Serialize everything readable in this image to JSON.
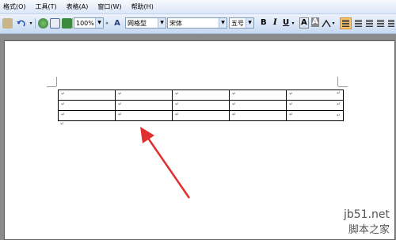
{
  "menu": [
    {
      "label": "格式(O)"
    },
    {
      "label": "工具(T)"
    },
    {
      "label": "表格(A)"
    },
    {
      "label": "窗口(W)"
    },
    {
      "label": "帮助(H)"
    }
  ],
  "toolbar": {
    "zoom": "100%",
    "style_select": "网格型",
    "font_select": "宋体",
    "size_select": "五号",
    "bold": "B",
    "italic": "I",
    "underline": "U",
    "font_color": "A",
    "highlight": "A"
  },
  "document": {
    "table": {
      "rows": [
        [
          "↵",
          "↵",
          "↵",
          "↵",
          "↵"
        ],
        [
          "↵",
          "↵",
          "↵",
          "↵",
          "↵"
        ],
        [
          "↵",
          "↵",
          "↵",
          "↵",
          "↵"
        ]
      ]
    },
    "row_end_mark": "↵",
    "paragraph_mark": "↵"
  },
  "annotation": {
    "arrow_color": "#e03030"
  },
  "watermark": {
    "site": "jb51.net",
    "title": "脚本之家"
  },
  "colors": {
    "accent": "#d98a2b",
    "toolbar": "#c7d8f1"
  }
}
